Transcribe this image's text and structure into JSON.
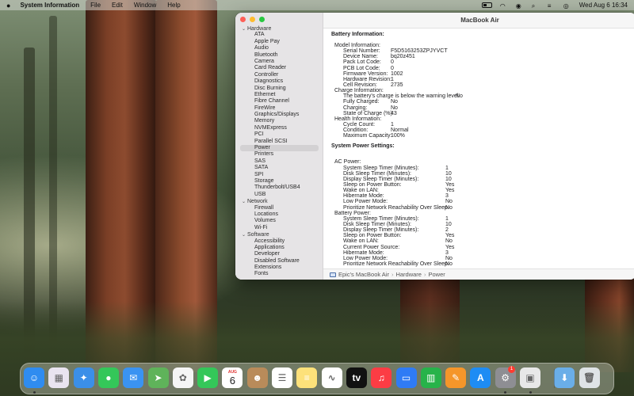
{
  "menubar": {
    "app_name": "System Information",
    "menus": [
      "File",
      "Edit",
      "Window",
      "Help"
    ],
    "clock": "Wed Aug 6  16:34"
  },
  "window": {
    "title": "MacBook Air",
    "sidebar": {
      "hardware_label": "Hardware",
      "hardware_items": [
        "ATA",
        "Apple Pay",
        "Audio",
        "Bluetooth",
        "Camera",
        "Card Reader",
        "Controller",
        "Diagnostics",
        "Disc Burning",
        "Ethernet",
        "Fibre Channel",
        "FireWire",
        "Graphics/Displays",
        "Memory",
        "NVMExpress",
        "PCI",
        "Parallel SCSI",
        "Power",
        "Printers",
        "SAS",
        "SATA",
        "SPI",
        "Storage",
        "Thunderbolt/USB4",
        "USB"
      ],
      "selected": "Power",
      "network_label": "Network",
      "network_items": [
        "Firewall",
        "Locations",
        "Volumes",
        "Wi-Fi"
      ],
      "software_label": "Software",
      "software_items": [
        "Accessibility",
        "Applications",
        "Developer",
        "Disabled Software",
        "Extensions",
        "Fonts"
      ]
    },
    "battery": {
      "title": "Battery Information:",
      "model_label": "Model Information:",
      "model": [
        {
          "k": "Serial Number:",
          "v": "F5D5163253ZPJYVCT"
        },
        {
          "k": "Device Name:",
          "v": "bq20z451"
        },
        {
          "k": "Pack Lot Code:",
          "v": "0"
        },
        {
          "k": "PCB Lot Code:",
          "v": "0"
        },
        {
          "k": "Firmware Version:",
          "v": "1002"
        },
        {
          "k": "Hardware Revision:",
          "v": "1"
        },
        {
          "k": "Cell Revision:",
          "v": "2735"
        }
      ],
      "charge_label": "Charge Information:",
      "charge": [
        {
          "k": "The battery's charge is below the warning level:",
          "v": "No"
        },
        {
          "k": "Fully Charged:",
          "v": "No"
        },
        {
          "k": "Charging:",
          "v": "No"
        },
        {
          "k": "State of Charge (%):",
          "v": "43"
        }
      ],
      "health_label": "Health Information:",
      "health": [
        {
          "k": "Cycle Count:",
          "v": "1"
        },
        {
          "k": "Condition:",
          "v": "Normal"
        },
        {
          "k": "Maximum Capacity:",
          "v": "100%"
        }
      ]
    },
    "power": {
      "title": "System Power Settings:",
      "ac_label": "AC Power:",
      "ac": [
        {
          "k": "System Sleep Timer (Minutes):",
          "v": "1"
        },
        {
          "k": "Disk Sleep Timer (Minutes):",
          "v": "10"
        },
        {
          "k": "Display Sleep Timer (Minutes):",
          "v": "10"
        },
        {
          "k": "Sleep on Power Button:",
          "v": "Yes"
        },
        {
          "k": "Wake on LAN:",
          "v": "Yes"
        },
        {
          "k": "Hibernate Mode:",
          "v": "3"
        },
        {
          "k": "Low Power Mode:",
          "v": "No"
        },
        {
          "k": "Prioritize Network Reachability Over Sleep:",
          "v": "No"
        }
      ],
      "battery_label": "Battery Power:",
      "battery": [
        {
          "k": "System Sleep Timer (Minutes):",
          "v": "1"
        },
        {
          "k": "Disk Sleep Timer (Minutes):",
          "v": "10"
        },
        {
          "k": "Display Sleep Timer (Minutes):",
          "v": "2"
        },
        {
          "k": "Sleep on Power Button:",
          "v": "Yes"
        },
        {
          "k": "Wake on LAN:",
          "v": "No"
        },
        {
          "k": "Current Power Source:",
          "v": "Yes"
        },
        {
          "k": "Hibernate Mode:",
          "v": "3"
        },
        {
          "k": "Low Power Mode:",
          "v": "No"
        },
        {
          "k": "Prioritize Network Reachability Over Sleep:",
          "v": "No"
        }
      ]
    },
    "path": {
      "device": "Epic's MacBook Air",
      "section": "Hardware",
      "item": "Power"
    }
  },
  "dock": {
    "calendar_month": "AUG",
    "calendar_day": "6",
    "tv_label": "tv",
    "settings_badge": "1",
    "apps": [
      {
        "name": "finder-icon",
        "color": "#2f8cf0",
        "glyph": "☺"
      },
      {
        "name": "launchpad-icon",
        "color": "#e9e4f0",
        "glyph": "▦"
      },
      {
        "name": "safari-icon",
        "color": "#3b8fe8",
        "glyph": "✦"
      },
      {
        "name": "messages-icon",
        "color": "#34c759",
        "glyph": "●"
      },
      {
        "name": "mail-icon",
        "color": "#3a93f2",
        "glyph": "✉"
      },
      {
        "name": "maps-icon",
        "color": "#5fb35a",
        "glyph": "➤"
      },
      {
        "name": "photos-icon",
        "color": "#f5f5f5",
        "glyph": "✿"
      },
      {
        "name": "facetime-icon",
        "color": "#34c759",
        "glyph": "▶"
      },
      {
        "name": "calendar-icon",
        "color": "#ffffff",
        "glyph": ""
      },
      {
        "name": "contacts-icon",
        "color": "#b98b5a",
        "glyph": "☻"
      },
      {
        "name": "reminders-icon",
        "color": "#ffffff",
        "glyph": "☰"
      },
      {
        "name": "notes-icon",
        "color": "#fde17a",
        "glyph": "≡"
      },
      {
        "name": "freeform-icon",
        "color": "#ffffff",
        "glyph": "∿"
      },
      {
        "name": "tv-icon",
        "color": "#111111",
        "glyph": ""
      },
      {
        "name": "music-icon",
        "color": "#fc3c44",
        "glyph": "♫"
      },
      {
        "name": "keynote-icon",
        "color": "#2f7bf5",
        "glyph": "▭"
      },
      {
        "name": "numbers-icon",
        "color": "#27b34a",
        "glyph": "▥"
      },
      {
        "name": "pages-icon",
        "color": "#f5962a",
        "glyph": "✎"
      },
      {
        "name": "app-store-icon",
        "color": "#1e8cf4",
        "glyph": "A"
      },
      {
        "name": "system-settings-icon",
        "color": "#8e8e93",
        "glyph": "⚙"
      },
      {
        "name": "system-information-icon",
        "color": "#e8e8e8",
        "glyph": "▣"
      },
      {
        "name": "downloads-folder-icon",
        "color": "#6aaee8",
        "glyph": "⬇"
      },
      {
        "name": "trash-icon",
        "color": "#dfe3e6",
        "glyph": "🗑"
      }
    ]
  }
}
